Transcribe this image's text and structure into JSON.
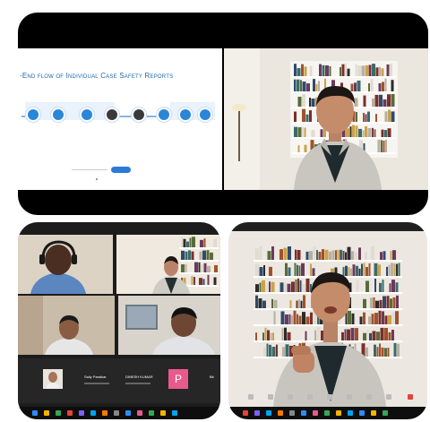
{
  "slide": {
    "title": "-End flow of Individual Case Safety Reports",
    "flow_nodes": [
      "",
      "",
      "",
      "",
      "",
      "",
      "",
      ""
    ],
    "flow_labels": [
      "",
      "",
      "",
      "",
      "",
      "",
      "",
      ""
    ]
  },
  "participants": [
    {
      "name": "Sally Paralkar"
    },
    {
      "name": "DINESH KUMAR"
    },
    {
      "name": "P"
    },
    {
      "name": "Bit"
    }
  ],
  "colors": {
    "slide_title": "#1b67b4",
    "flow_blue": "#2a86d9",
    "flow_dark": "#3a3a3a",
    "participant_pink": "#e85a8c",
    "zoom_blue": "#2d8cff"
  },
  "icons": [
    "mute-icon",
    "video-icon",
    "participants-icon",
    "share-screen-icon",
    "chat-icon",
    "record-icon",
    "reactions-icon",
    "apps-icon",
    "end-icon"
  ]
}
